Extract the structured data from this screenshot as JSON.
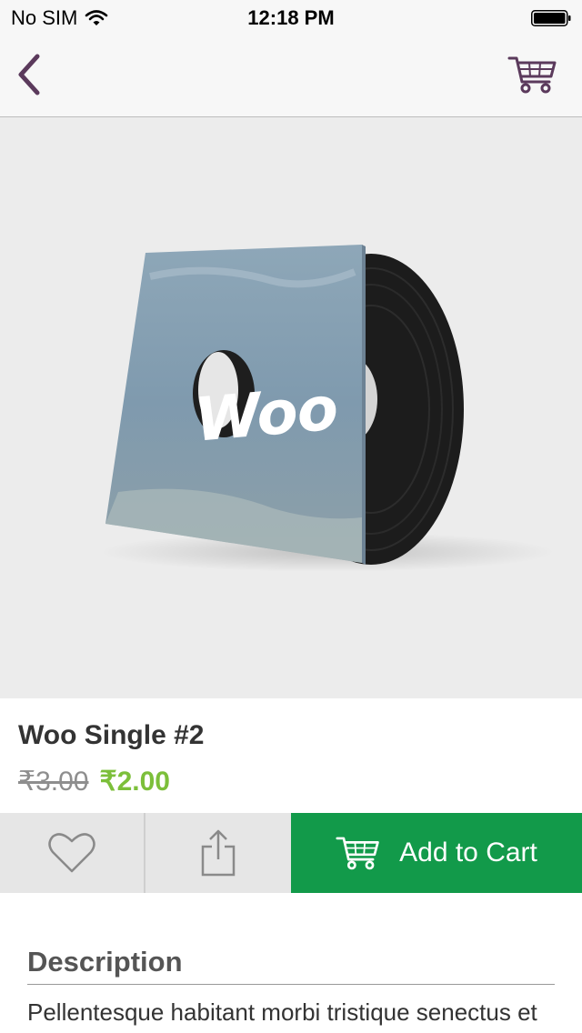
{
  "status_bar": {
    "carrier": "No SIM",
    "time": "12:18 PM",
    "icons": [
      "wifi-icon",
      "battery-icon"
    ]
  },
  "nav": {
    "back_icon": "chevron-left-icon",
    "cart_icon": "cart-icon",
    "accent_color": "#5b3a5c"
  },
  "product": {
    "image_logo_text": "Woo",
    "title": "Woo Single #2",
    "regular_price": "₹3.00",
    "sale_price": "₹2.00",
    "sale_price_color": "#7cbf3a"
  },
  "actions": {
    "wishlist_icon": "heart-icon",
    "share_icon": "share-icon",
    "add_to_cart_label": "Add to Cart",
    "add_to_cart_color": "#129a4a"
  },
  "description": {
    "heading": "Description",
    "text": "Pellentesque habitant morbi tristique senectus et"
  }
}
